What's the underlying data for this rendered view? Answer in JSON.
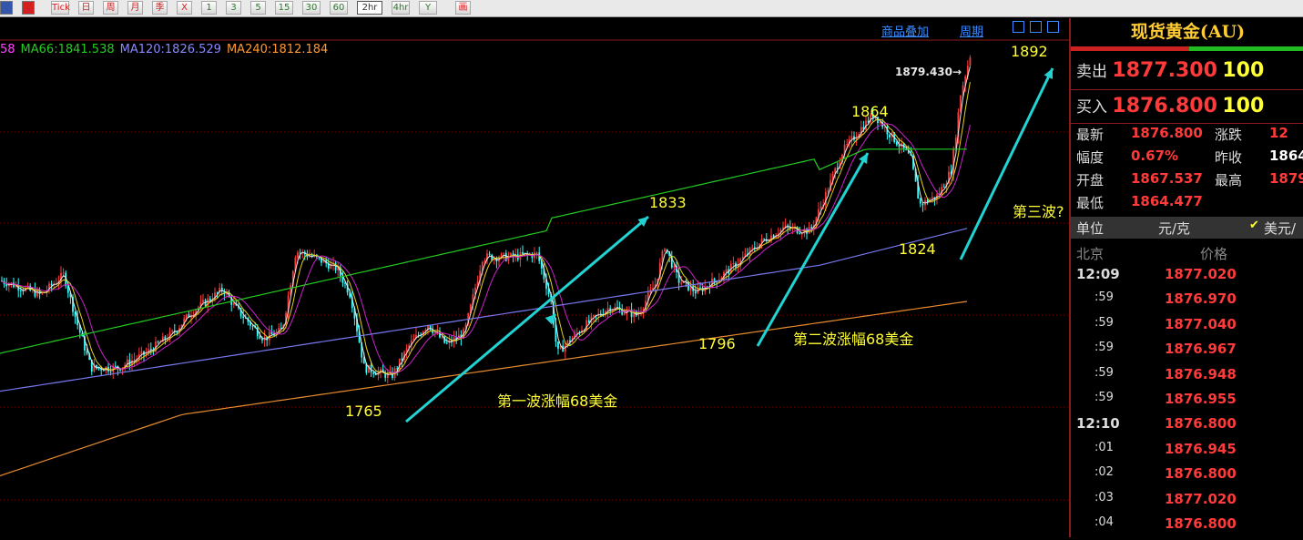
{
  "toolbar": {
    "buttons": [
      {
        "label": "",
        "icon": "table-icon",
        "color": "#3355aa"
      },
      {
        "label": "",
        "icon": "chart-icon",
        "color": "#d42020"
      },
      {
        "label": "Tick",
        "color": "#d42020"
      },
      {
        "label": "日",
        "color": "#d42020"
      },
      {
        "label": "周",
        "color": "#d42020"
      },
      {
        "label": "月",
        "color": "#d42020"
      },
      {
        "label": "季",
        "color": "#d42020"
      },
      {
        "label": "X",
        "color": "#d42020"
      },
      {
        "label": "1",
        "color": "#2a7a2a"
      },
      {
        "label": "3",
        "color": "#2a7a2a"
      },
      {
        "label": "5",
        "color": "#2a7a2a"
      },
      {
        "label": "15",
        "color": "#2a7a2a"
      },
      {
        "label": "30",
        "color": "#2a7a2a"
      },
      {
        "label": "60",
        "color": "#2a7a2a"
      },
      {
        "label": "2hr",
        "color": "#2a7a2a",
        "active": true
      },
      {
        "label": "4hr",
        "color": "#2a7a2a"
      },
      {
        "label": "Y",
        "color": "#2a7a2a"
      },
      {
        "label": "画",
        "color": "#d42020"
      }
    ]
  },
  "chart": {
    "links": {
      "overlay": "商品叠加",
      "period": "周期"
    },
    "ma_legend": [
      {
        "text": "58",
        "color": "#ff44ff"
      },
      {
        "text": "MA66:1841.538",
        "color": "#22cc22"
      },
      {
        "text": "MA120:1826.529",
        "color": "#8888ff"
      },
      {
        "text": "MA240:1812.184",
        "color": "#ff9933"
      }
    ],
    "last_price_label": "1879.430→",
    "annotations": {
      "p1765": "1765",
      "p1833": "1833",
      "p1796": "1796",
      "p1864": "1864",
      "p1824": "1824",
      "p1892": "1892",
      "wave1": "第一波涨幅68美金",
      "wave2": "第二波涨幅68美金",
      "wave3": "第三波?"
    },
    "colors": {
      "up": "#ff3a3a",
      "down": "#33ffff",
      "ma_fast": "#e6e6e6",
      "ma_yellow": "#e6d21a",
      "ma_magenta": "#cc22cc",
      "ma66": "#22cc22",
      "ma120": "#7777ee",
      "ma240": "#e68a2e",
      "arrow": "#22d3d3",
      "grid": "#7a0000"
    }
  },
  "chart_data": {
    "type": "candlestick",
    "symbol": "现货黄金(AU)",
    "period": "2hr",
    "last_price": 1879.43,
    "key_levels": [
      1765,
      1833,
      1796,
      1864,
      1824,
      1892
    ],
    "moving_averages": {
      "MA66": 1841.538,
      "MA120": 1826.529,
      "MA240": 1812.184
    }
  },
  "quote": {
    "title": "现货黄金(AU)",
    "sell_label": "卖出",
    "sell_price": "1877.300",
    "sell_qty": "100",
    "buy_label": "买入",
    "buy_price": "1876.800",
    "buy_qty": "100",
    "rows": [
      {
        "l1": "最新",
        "v1": "1876.800",
        "l2": "涨跌",
        "v2": "12"
      },
      {
        "l1": "幅度",
        "v1": "0.67%",
        "l2": "昨收",
        "v2": "1864"
      },
      {
        "l1": "开盘",
        "v1": "1867.537",
        "l2": "最高",
        "v2": "1879"
      },
      {
        "l1": "最低",
        "v1": "1864.477",
        "l2": "",
        "v2": ""
      }
    ],
    "unit_label": "单位",
    "unit_value": "元/克",
    "currency_check": "✔",
    "currency_label": "美元/",
    "tick_header_left": "北京",
    "tick_header_right": "价格",
    "ticks": [
      {
        "time": "12:09",
        "price": "1877.020",
        "major": true
      },
      {
        "time": ":59",
        "price": "1876.970"
      },
      {
        "time": ":59",
        "price": "1877.040"
      },
      {
        "time": ":59",
        "price": "1876.967"
      },
      {
        "time": ":59",
        "price": "1876.948"
      },
      {
        "time": ":59",
        "price": "1876.955"
      },
      {
        "time": "12:10",
        "price": "1876.800",
        "major": true
      },
      {
        "time": ":01",
        "price": "1876.945"
      },
      {
        "time": ":02",
        "price": "1876.800"
      },
      {
        "time": ":03",
        "price": "1877.020"
      },
      {
        "time": ":04",
        "price": "1876.800"
      }
    ]
  }
}
